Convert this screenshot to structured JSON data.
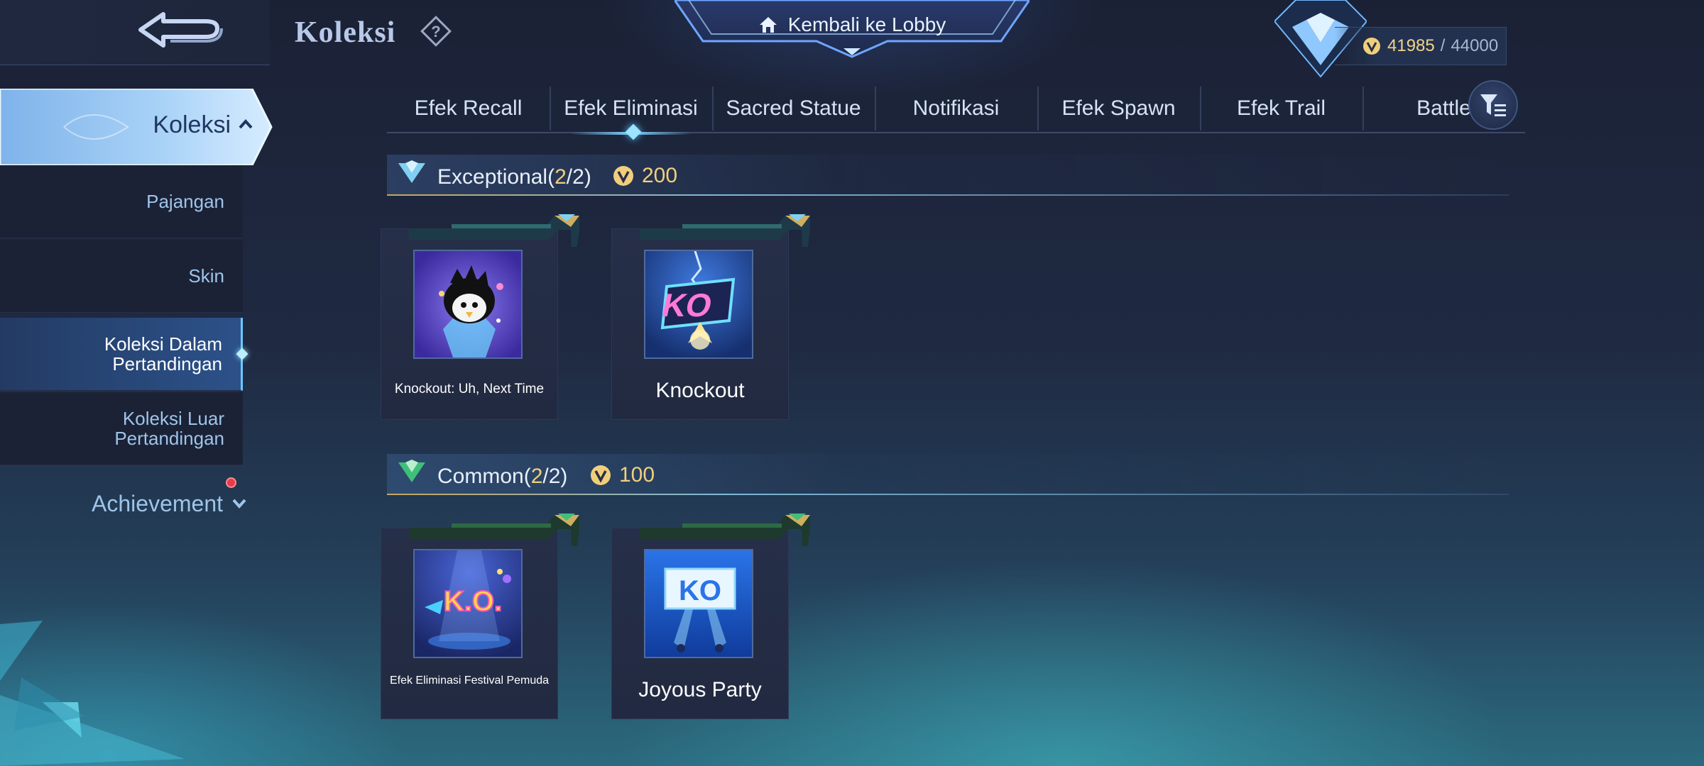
{
  "header": {
    "title": "Koleksi",
    "lobby_label": "Kembali ke Lobby",
    "points_current": "41985",
    "points_separator": "/",
    "points_max": "44000"
  },
  "sidebar": {
    "active_group": "Koleksi",
    "items": [
      {
        "label": "Pajangan"
      },
      {
        "label": "Skin"
      },
      {
        "label_line1": "Koleksi Dalam",
        "label_line2": "Pertandingan"
      },
      {
        "label_line1": "Koleksi Luar",
        "label_line2": "Pertandingan"
      }
    ],
    "achievement": "Achievement"
  },
  "tabs": [
    {
      "label": "Efek Recall"
    },
    {
      "label": "Efek Eliminasi"
    },
    {
      "label": "Sacred Statue"
    },
    {
      "label": "Notifikasi"
    },
    {
      "label": "Efek Spawn"
    },
    {
      "label": "Efek Trail"
    },
    {
      "label": "Battle"
    }
  ],
  "sections": [
    {
      "name": "Exceptional",
      "count_open": "(",
      "count_owned": "2",
      "count_sep": "/",
      "count_total": "2",
      "count_close": ")",
      "points": "200",
      "accent": "#58b8e8",
      "items": [
        {
          "name": "Knockout: Uh, Next Time",
          "icon": "penguin-character-art"
        },
        {
          "name": "Knockout",
          "icon": "ko-lightning-art"
        }
      ]
    },
    {
      "name": "Common",
      "count_open": "(",
      "count_owned": "2",
      "count_sep": "/",
      "count_total": "2",
      "count_close": ")",
      "points": "100",
      "accent": "#3fbf7a",
      "items": [
        {
          "name": "Efek Eliminasi Festival Pemuda",
          "icon": "ko-festival-art"
        },
        {
          "name": "Joyous Party",
          "icon": "ko-spotlight-art"
        }
      ]
    }
  ],
  "colors": {
    "gold": "#f0cf7c",
    "sidebar_active": "#6cc8ff",
    "notification": "#e83c4a"
  }
}
